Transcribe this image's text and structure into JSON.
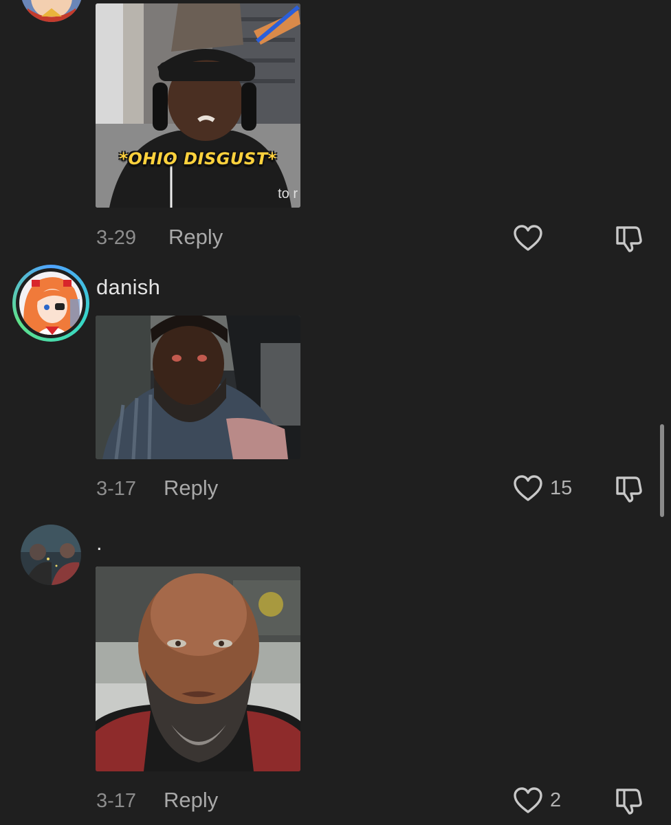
{
  "comments": [
    {
      "username": "",
      "text": "",
      "date": "3-29",
      "reply_label": "Reply",
      "likes": "",
      "media": {
        "caption": "*OHIO DISGUST*",
        "subtitle_fragment": "to r"
      }
    },
    {
      "username": "danish",
      "text": "",
      "date": "3-17",
      "reply_label": "Reply",
      "likes": "15",
      "media": {}
    },
    {
      "username": ".",
      "text": "",
      "date": "3-17",
      "reply_label": "Reply",
      "likes": "2",
      "media": {}
    }
  ],
  "icons": {
    "like": "heart-outline-icon",
    "dislike": "thumbs-down-outline-icon"
  },
  "colors": {
    "background": "#1f1f1f",
    "username": "#e4e4e4",
    "date": "#8d8d8d",
    "reply": "#a9a9a9",
    "icon": "#c8c8c8",
    "ring_gradient": [
      "#4fa3ff",
      "#37d7c6",
      "#5fe08a"
    ]
  }
}
